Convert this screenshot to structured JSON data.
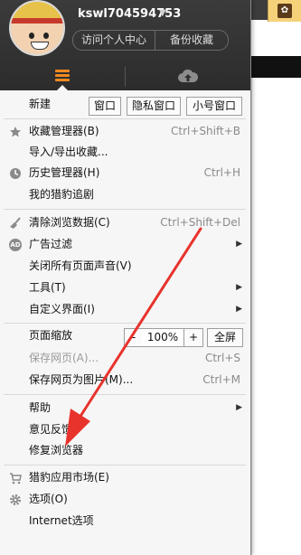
{
  "header": {
    "username": "kswl704594753",
    "visit_label": "访问个人中心",
    "backup_label": "备份收藏"
  },
  "menu": {
    "new": {
      "label": "新建",
      "window": "窗口",
      "private_window": "隐私窗口",
      "small_window": "小号窗口"
    },
    "favorites": {
      "label": "收藏管理器(B)",
      "shortcut": "Ctrl+Shift+B"
    },
    "import_export": {
      "label": "导入/导出收藏..."
    },
    "history": {
      "label": "历史管理器(H)",
      "shortcut": "Ctrl+H"
    },
    "follow": {
      "label": "我的猎豹追剧"
    },
    "clear_data": {
      "label": "清除浏览数据(C)",
      "shortcut": "Ctrl+Shift+Del"
    },
    "adblock": {
      "label": "广告过滤",
      "icon_text": "AD"
    },
    "mute": {
      "label": "关闭所有页面声音(V)"
    },
    "tools": {
      "label": "工具(T)"
    },
    "customize": {
      "label": "自定义界面(I)"
    },
    "zoom": {
      "label": "页面缩放",
      "minus": "-",
      "value": "100%",
      "plus": "+",
      "fullscreen": "全屏"
    },
    "save_page": {
      "label": "保存网页(A)...",
      "shortcut": "Ctrl+S"
    },
    "save_image": {
      "label": "保存网页为图片(M)...",
      "shortcut": "Ctrl+M"
    },
    "help": {
      "label": "帮助"
    },
    "feedback": {
      "label": "意见反馈"
    },
    "repair": {
      "label": "修复浏览器"
    },
    "app_market": {
      "label": "猎豹应用市场(E)"
    },
    "options": {
      "label": "选项(O)"
    },
    "internet_options": {
      "label": "Internet选项"
    }
  },
  "colors": {
    "accent": "#f08a1e",
    "annotation_arrow": "#e8322c"
  }
}
